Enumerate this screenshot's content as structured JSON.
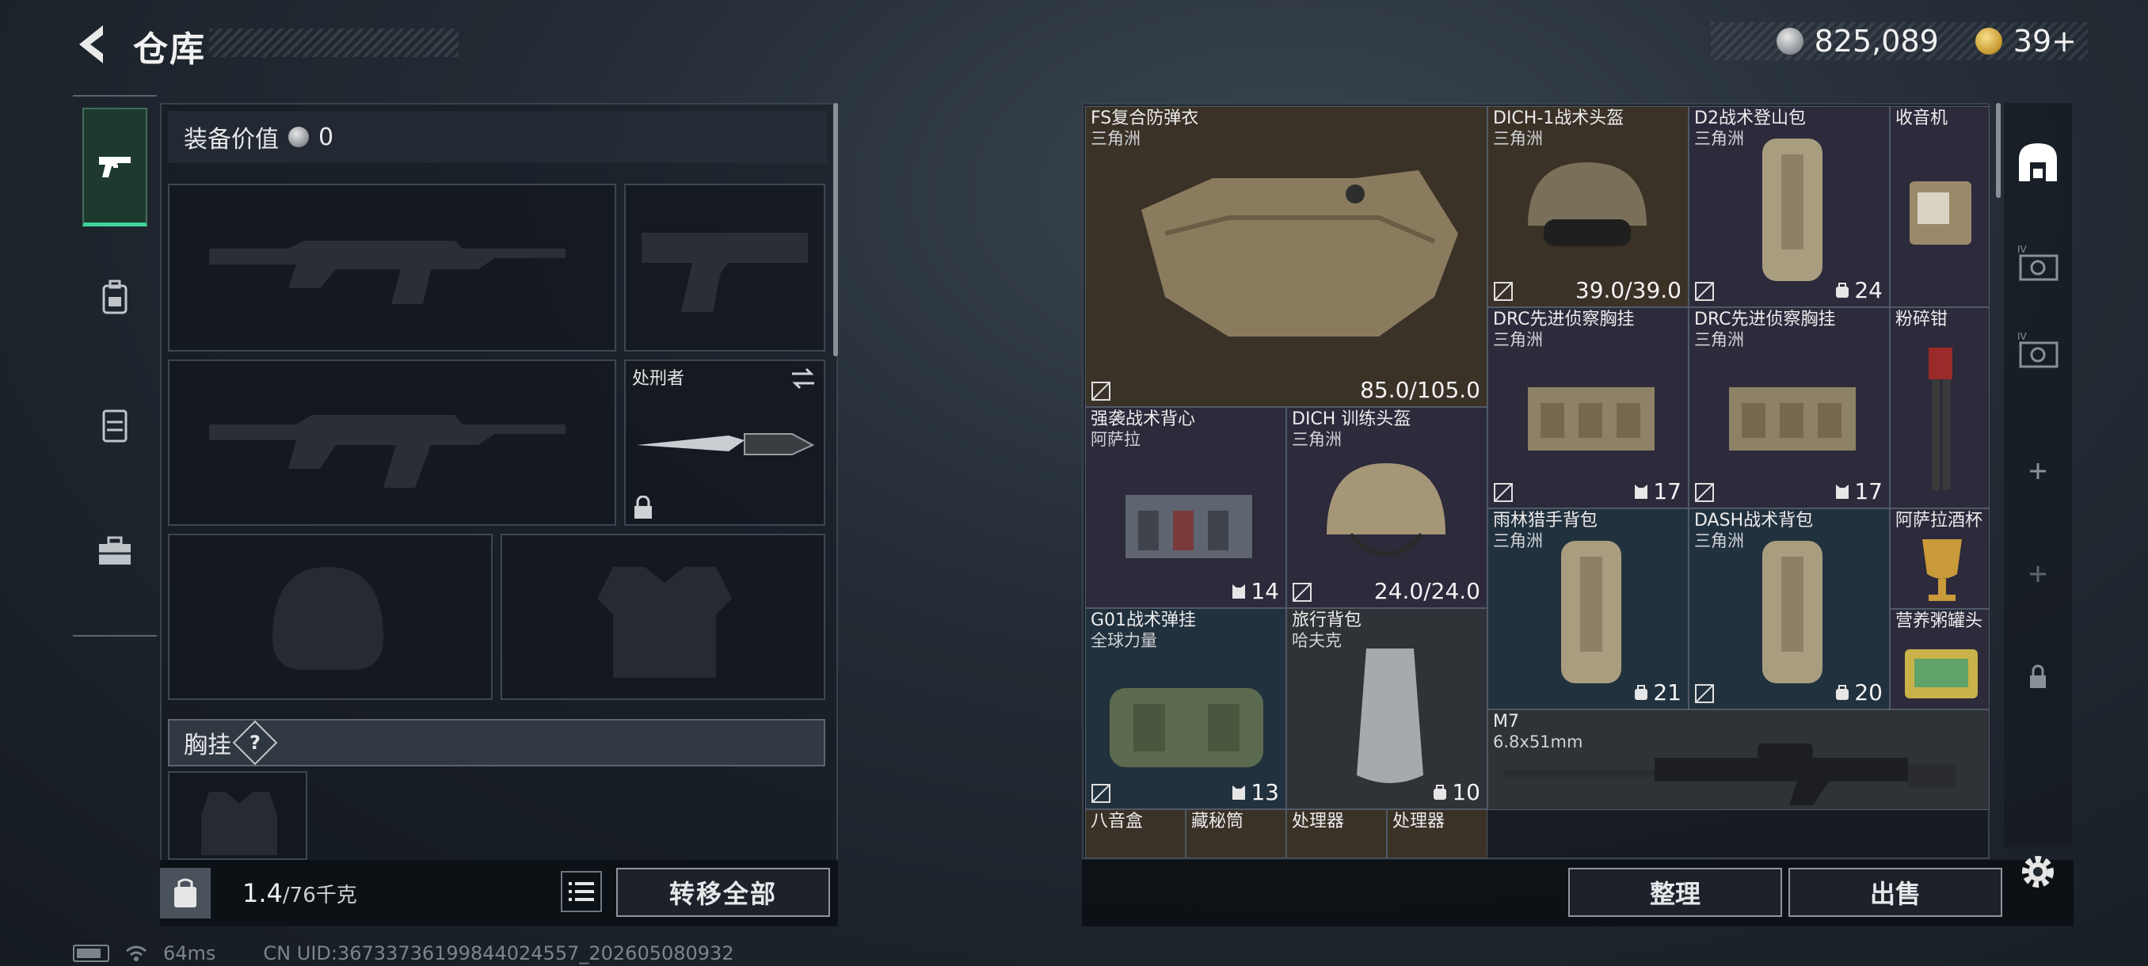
{
  "header": {
    "title": "仓库",
    "silver_amount": "825,089",
    "gold_amount": "39+"
  },
  "left_tabs": [
    "pistol-icon",
    "backpack-icon",
    "rig-icon",
    "toolbox-icon"
  ],
  "loadout": {
    "value_label": "装备价值",
    "value": "0",
    "knife_name": "处刑者",
    "vest_header": "胸挂",
    "help_label": "?"
  },
  "left_bottom": {
    "weight_current": "1.4",
    "weight_max": "/76千克",
    "transfer_all": "转移全部"
  },
  "status": {
    "ping": "64ms",
    "uid": "CN UID:3673373619984402455​7_202605080932"
  },
  "items": [
    {
      "name": "FS复合防弹衣",
      "sub": "三角洲",
      "stat": "85.0/105.0"
    },
    {
      "name": "DICH-1战术头盔",
      "sub": "三角洲",
      "stat": "39.0/39.0"
    },
    {
      "name": "D2战术登山包",
      "sub": "三角洲",
      "count": "24"
    },
    {
      "name": "收音机",
      "sub": ""
    },
    {
      "name": "DRC先进侦察胸挂",
      "sub": "三角洲",
      "count": "17"
    },
    {
      "name": "DRC先进侦察胸挂",
      "sub": "三角洲",
      "count": "17"
    },
    {
      "name": "粉碎钳",
      "sub": ""
    },
    {
      "name": "强袭战术背心",
      "sub": "阿萨拉",
      "count": "14"
    },
    {
      "name": "DICH 训练头盔",
      "sub": "三角洲",
      "stat": "24.0/24.0"
    },
    {
      "name": "雨林猎手背包",
      "sub": "三角洲",
      "count": "21"
    },
    {
      "name": "DASH战术背包",
      "sub": "三角洲",
      "count": "20"
    },
    {
      "name": "阿萨拉酒杯",
      "sub": ""
    },
    {
      "name": "G01战术弹挂",
      "sub": "全球力量",
      "count": "13"
    },
    {
      "name": "旅行背包",
      "sub": "哈夫克",
      "count": "10"
    },
    {
      "name": "营养粥罐头",
      "sub": ""
    },
    {
      "name": "M7",
      "sub": "6.8x51mm"
    },
    {
      "name": "八音盒",
      "sub": ""
    },
    {
      "name": "藏秘筒",
      "sub": ""
    },
    {
      "name": "处理器",
      "sub": ""
    },
    {
      "name": "处理器",
      "sub": ""
    }
  ],
  "right_tabs": [
    "storage-icon",
    "case-iv-icon",
    "case-iv-icon-2",
    "add-icon",
    "add-icon-2",
    "lock-icon"
  ],
  "right_bottom": {
    "sort": "整理",
    "sell": "出售"
  },
  "colors": {
    "accent_green": "#3fd49b",
    "brown_cell": "#3a3127",
    "purple_cell": "#2c2a3b",
    "blue_cell": "#22313e"
  }
}
